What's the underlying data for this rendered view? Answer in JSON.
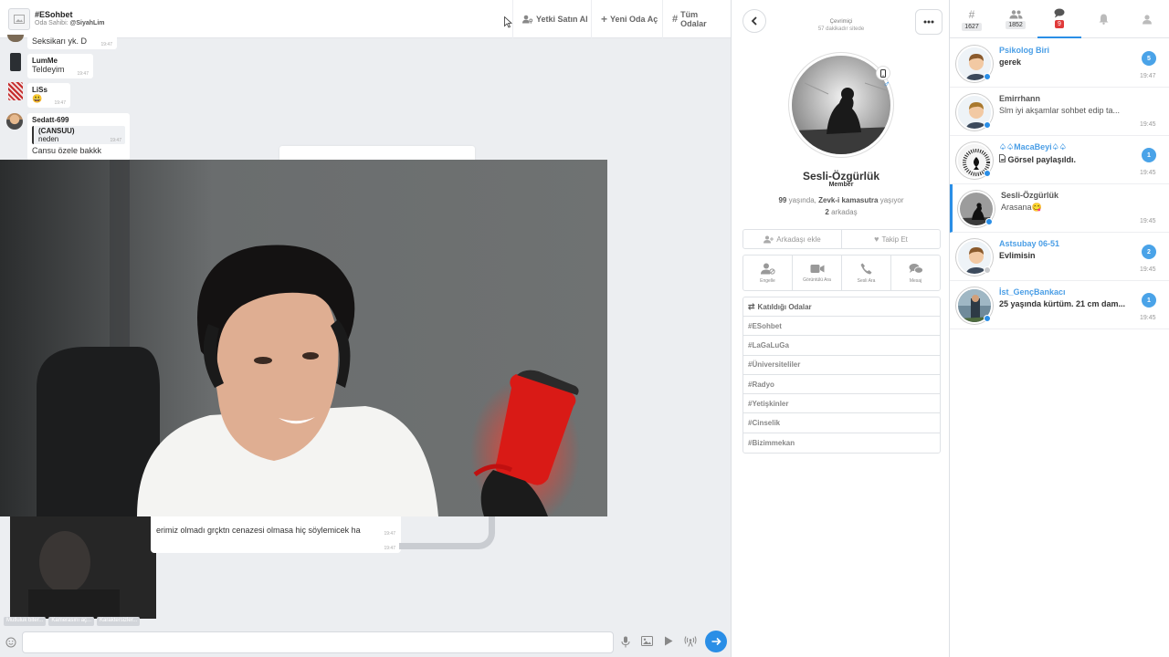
{
  "header": {
    "room_name": "#ESohbet",
    "owner_label": "Oda Sahibi:",
    "owner_name": "@SiyahLim",
    "buy_auth": "Yetki Satın Al",
    "new_room": "Yeni Oda Aç",
    "all_rooms": "Tüm Odalar"
  },
  "messages": [
    {
      "user": "",
      "text": "Seksikarı yk. D",
      "time": "19:47"
    },
    {
      "user": "LumMe",
      "text": "Teldeyim",
      "time": "19:47"
    },
    {
      "user": "LiSs",
      "text": "😃",
      "time": "19:47"
    },
    {
      "user": "Sedatt-699",
      "quote_user": "(CANSUU)",
      "quote_text": "neden",
      "quote_time": "19:47",
      "text": "Cansu özele bakkk"
    }
  ],
  "video_message": {
    "text": "erimiz olmadı grçktn cenazesi olmasa hiç söylemicek ha",
    "time1": "19:47",
    "time2": "19:47"
  },
  "chips": [
    "Mutluluk biter...",
    "Kamerasını aç...",
    "Karaktersizler..."
  ],
  "composer": {
    "placeholder": ""
  },
  "profile": {
    "status": "Çevrimiçi",
    "since": "57 dakikadır sitede",
    "name": "Sesli-Özgürlük",
    "role": "Member",
    "age": "99",
    "age_suffix": "yaşında,",
    "city": "Zevk-i kamasutra",
    "city_suffix": "yaşıyor",
    "friends_count": "2",
    "friends_label": "arkadaş",
    "add_friend": "Arkadaşı ekle",
    "follow": "Takip Et",
    "actions": {
      "block": "Engelle",
      "video_call": "Görüntülü Ara",
      "voice_call": "Sesli Ara",
      "message": "Mesaj"
    },
    "rooms_title": "Katıldığı Odalar",
    "rooms": [
      "#ESohbet",
      "#LaGaLuGa",
      "#Üniversiteliler",
      "#Radyo",
      "#Yetişkinler",
      "#Cinselik",
      "#Bizimmekan"
    ]
  },
  "tabs": {
    "rooms_count": "1627",
    "users_count": "1852",
    "messages_count": "9"
  },
  "conversations": [
    {
      "name": "Psikolog Biri",
      "msg": "gerek",
      "badge": "5",
      "time": "19:47"
    },
    {
      "name": "Emirrhann",
      "msg": "Slm iyi akşamlar sohbet edip ta...",
      "badge": "",
      "time": "19:45"
    },
    {
      "name": "♤♤MacaBeyi♤♤",
      "msg": "Görsel paylaşıldı.",
      "badge": "1",
      "time": "19:45"
    },
    {
      "name": "Sesli-Özgürlük",
      "msg": "Arasana😋",
      "badge": "",
      "time": "19:45"
    },
    {
      "name": "Astsubay 06-51",
      "msg": "Evlimisin",
      "badge": "2",
      "time": "19:45"
    },
    {
      "name": "İst_GençBankacı",
      "msg": "25 yaşında kürtüm. 21 cm dam...",
      "badge": "1",
      "time": "19:45"
    }
  ],
  "colors": {
    "accent": "#2a8ee6",
    "badge_red": "#e03a3a",
    "mic_red": "#e81818"
  }
}
